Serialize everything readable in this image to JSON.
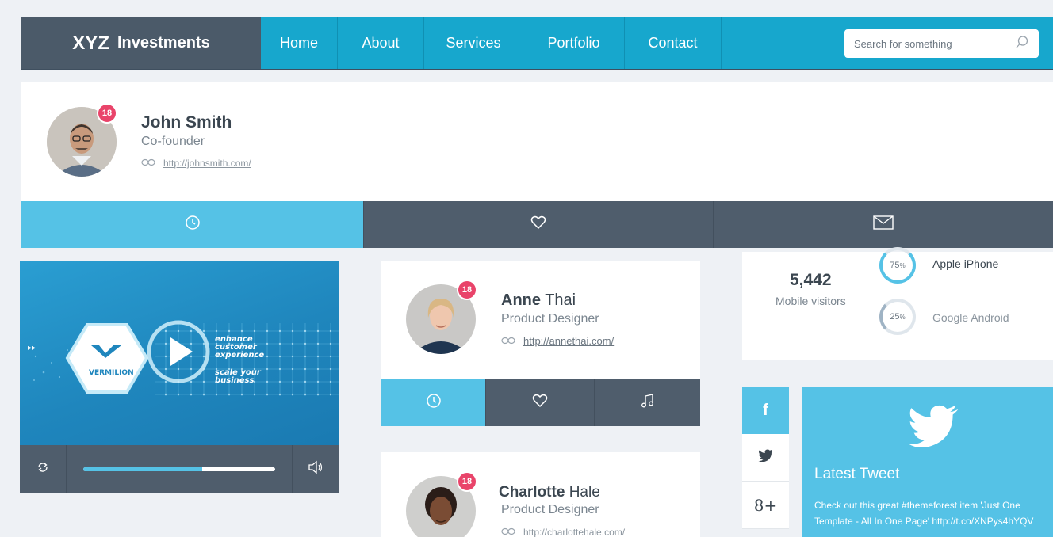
{
  "brand": {
    "name_bold": "XYZ",
    "name_rest": "Investments"
  },
  "nav": {
    "items": [
      "Home",
      "About",
      "Services",
      "Portfolio",
      "Contact"
    ]
  },
  "search": {
    "placeholder": "Search for something"
  },
  "profile": {
    "name": "John Smith",
    "role": "Co-founder",
    "link": "http://johnsmith.com/",
    "badge": "18",
    "tabs": [
      "clock-icon",
      "heart-icon",
      "mail-icon"
    ]
  },
  "video": {
    "overlay_line1": "enhance",
    "overlay_line2": "customer",
    "overlay_line3": "experience",
    "overlay_line4": "scale your",
    "overlay_line5": "business",
    "logo_text": "VERMILION",
    "progress": 0.62
  },
  "cards": [
    {
      "first": "Anne",
      "last": "Thai",
      "role": "Product Designer",
      "link": "http://annethai.com/",
      "badge": "18"
    },
    {
      "first": "Charlotte",
      "last": "Hale",
      "role": "Product Designer",
      "link": "http://charlottehale.com/",
      "badge": "18"
    }
  ],
  "stats": {
    "visitors_value": "5,442",
    "visitors_label": "Mobile visitors",
    "platforms": [
      {
        "label": "Apple iPhone",
        "percent": "75",
        "unit": "%"
      },
      {
        "label": "Google Android",
        "percent": "25",
        "unit": "%"
      }
    ]
  },
  "social": {
    "facebook": "f",
    "twitter": "twitter-icon",
    "gplus": "8+"
  },
  "tweet": {
    "title": "Latest Tweet",
    "text": "Check out this great #themeforest item 'Just One Template - All In One Page' http://t.co/XNPys4hYQV"
  },
  "colors": {
    "accent": "#17a7cd",
    "light_accent": "#55c2e6",
    "dark": "#4f5d6c",
    "badge": "#e9446a"
  }
}
